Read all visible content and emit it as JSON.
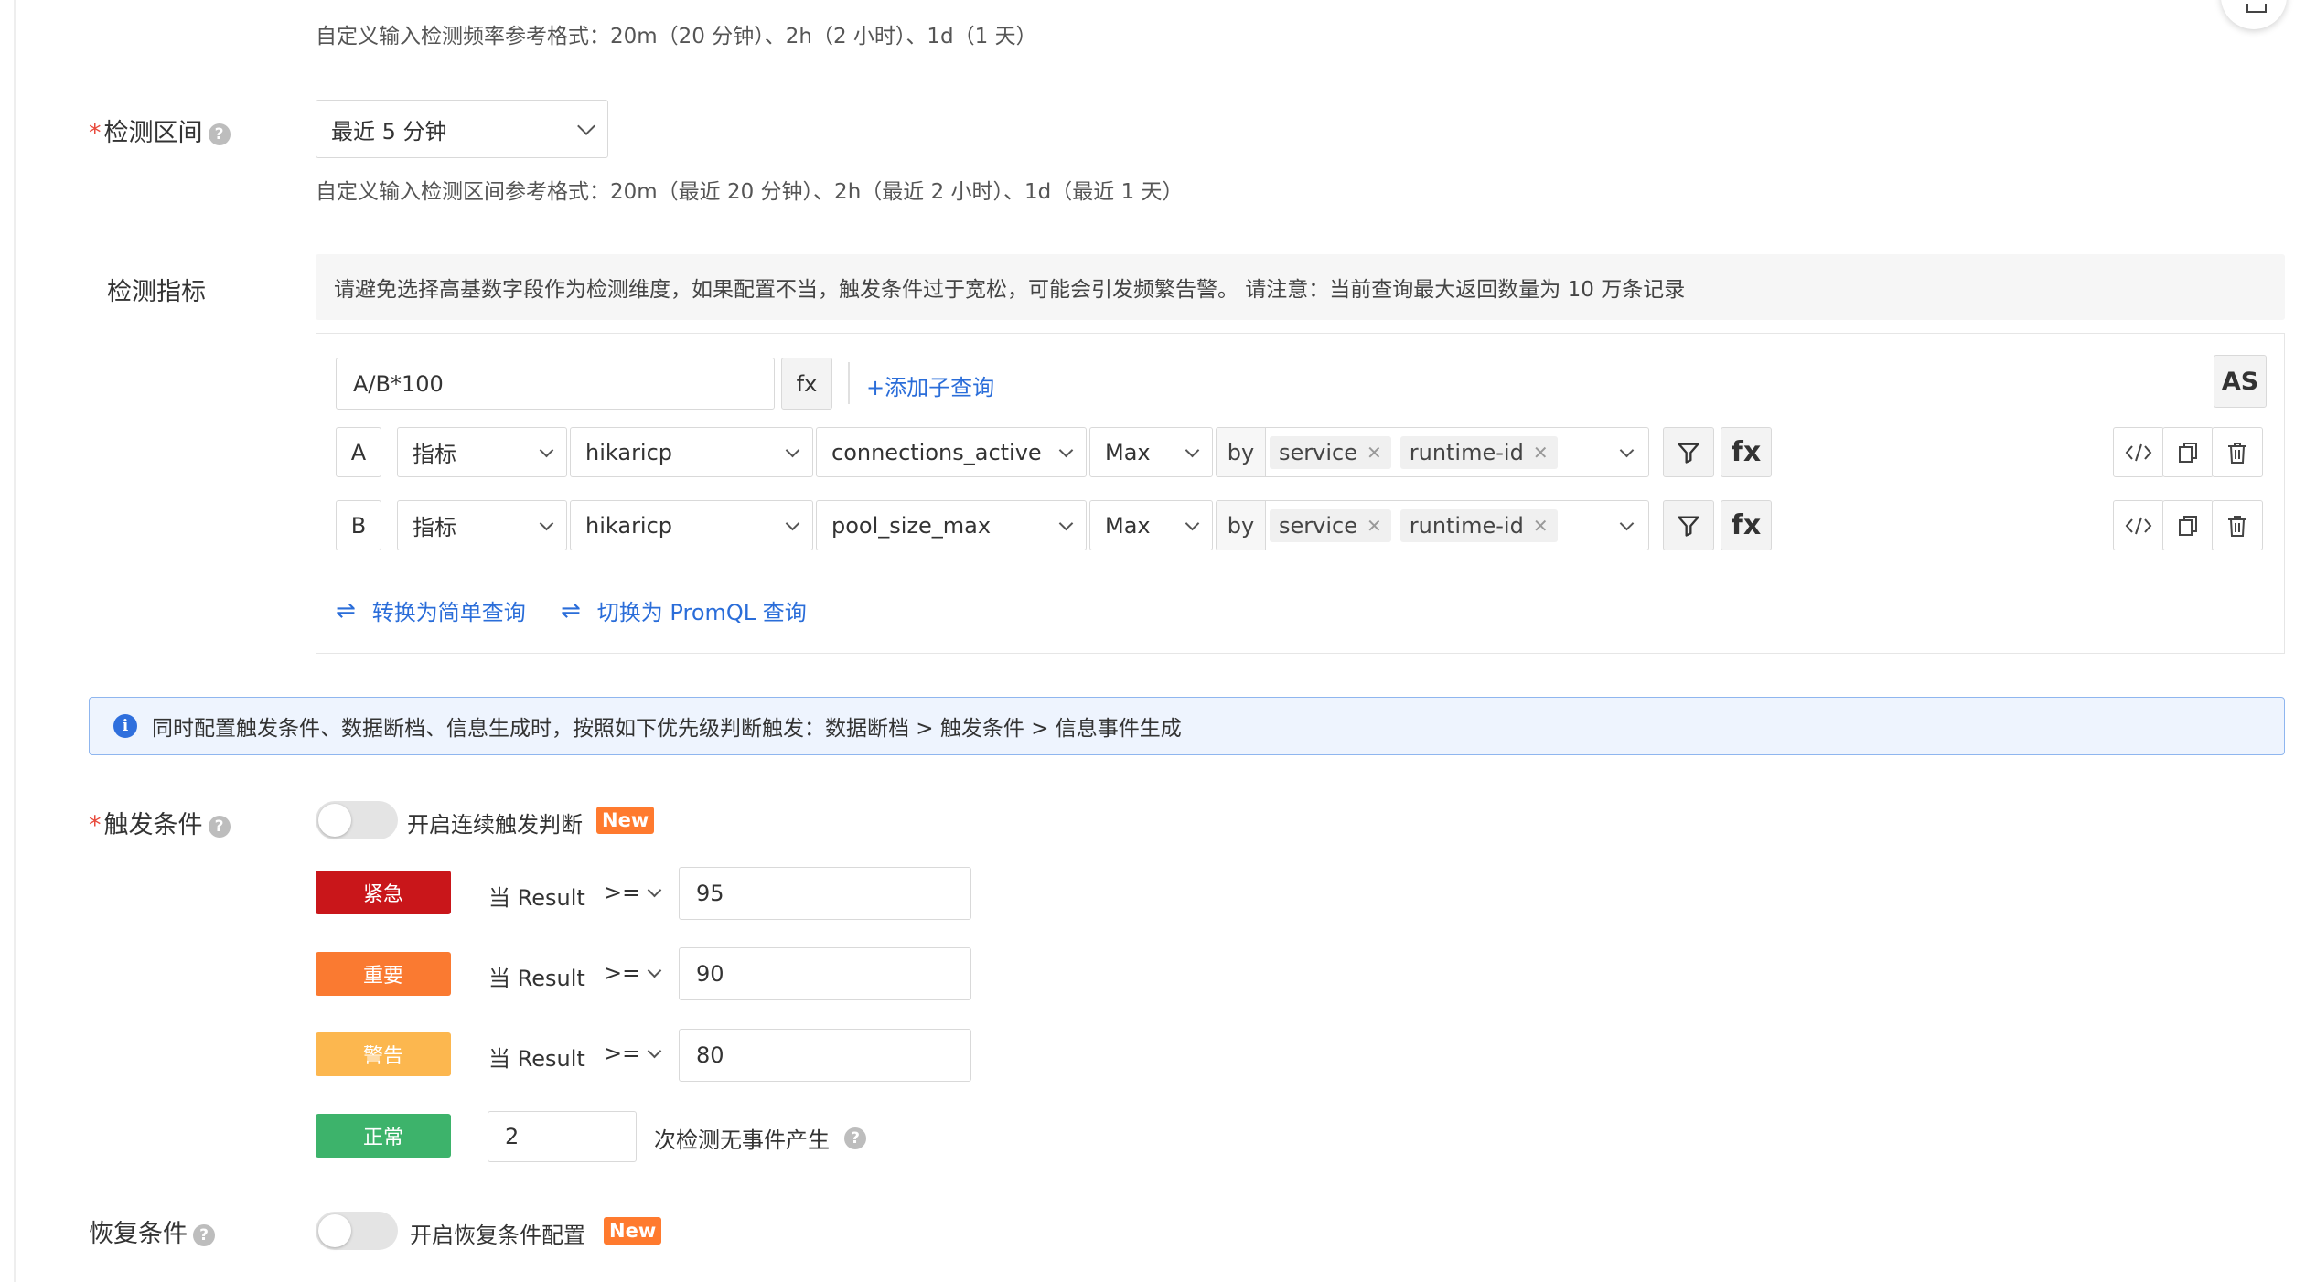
{
  "frequency_hint": "自定义输入检测频率参考格式：20m（20 分钟）、2h（2 小时）、1d（1 天）",
  "detect_range": {
    "required_mark": "*",
    "label": "检测区间",
    "help": "?",
    "value": "最近 5 分钟",
    "hint": "自定义输入检测区间参考格式：20m（最近 20 分钟）、2h（最近 2 小时）、1d（最近 1 天）"
  },
  "metrics": {
    "label": "检测指标",
    "notice": "请避免选择高基数字段作为检测维度，如果配置不当，触发条件过于宽松，可能会引发频繁告警。 请注意：当前查询最大返回数量为 10 万条记录",
    "expression": "A/B*100",
    "fx_label": "fx",
    "add_subquery": "+添加子查询",
    "as_label": "AS",
    "queries": [
      {
        "letter": "A",
        "type": "指标",
        "measurement": "hikaricp",
        "field": "connections_active",
        "agg": "Max",
        "by": "by",
        "tags": [
          "service",
          "runtime-id"
        ]
      },
      {
        "letter": "B",
        "type": "指标",
        "measurement": "hikaricp",
        "field": "pool_size_max",
        "agg": "Max",
        "by": "by",
        "tags": [
          "service",
          "runtime-id"
        ]
      }
    ],
    "fx_bold": "fx",
    "switch_simple": "转换为简单查询",
    "switch_promql": "切换为 PromQL 查询",
    "swap_glyph": "⇌"
  },
  "info_banner": {
    "icon": "i",
    "text": "同时配置触发条件、数据断档、信息生成时，按照如下优先级判断触发：数据断档 > 触发条件 > 信息事件生成"
  },
  "trigger": {
    "required_mark": "*",
    "label": "触发条件",
    "help": "?",
    "toggle_label": "开启连续触发判断",
    "new_badge": "New",
    "levels": [
      {
        "name": "紧急",
        "color": "#c9161a",
        "prefix": "当 Result",
        "op": ">=",
        "value": "95"
      },
      {
        "name": "重要",
        "color": "#fa7a31",
        "prefix": "当 Result",
        "op": ">=",
        "value": "90"
      },
      {
        "name": "警告",
        "color": "#fcb74f",
        "prefix": "当 Result",
        "op": ">=",
        "value": "80"
      }
    ],
    "normal": {
      "name": "正常",
      "color": "#3db36b",
      "value": "2",
      "suffix": "次检测无事件产生",
      "help": "?"
    }
  },
  "recovery": {
    "label": "恢复条件",
    "help": "?",
    "toggle_label": "开启恢复条件配置",
    "new_badge": "New"
  }
}
